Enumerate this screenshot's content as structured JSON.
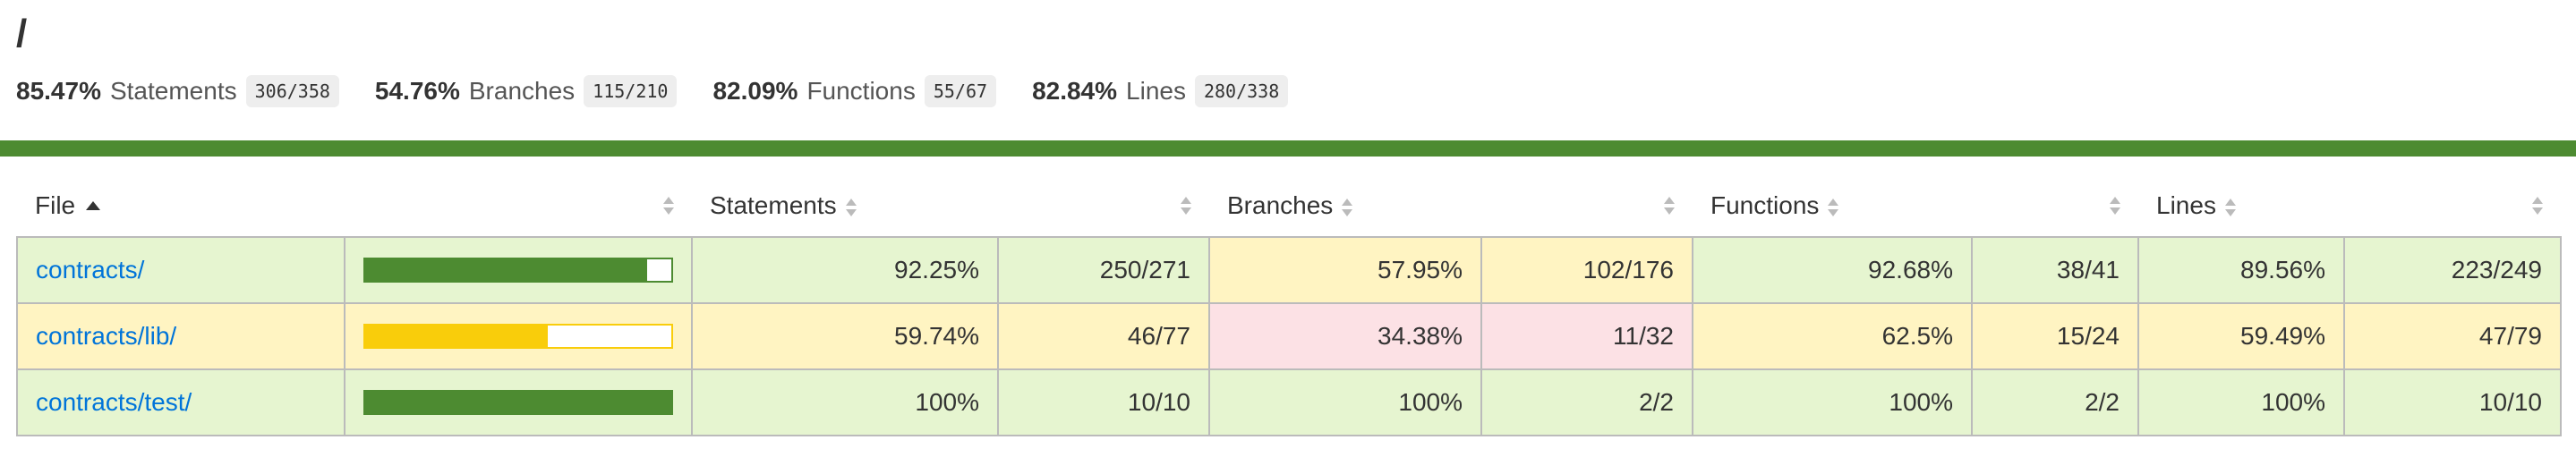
{
  "page": {
    "title": "/"
  },
  "summary": [
    {
      "pct": "85.47%",
      "label": "Statements",
      "frac": "306/358"
    },
    {
      "pct": "54.76%",
      "label": "Branches",
      "frac": "115/210"
    },
    {
      "pct": "82.09%",
      "label": "Functions",
      "frac": "55/67"
    },
    {
      "pct": "82.84%",
      "label": "Lines",
      "frac": "280/338"
    }
  ],
  "overall_status_color": "#4d8b31",
  "colors": {
    "high": "#e6f5d0",
    "medium": "#fff4c2",
    "low": "#fce1e5",
    "bar_high": "#4d8b31",
    "bar_medium": "#f9cd0b",
    "link": "#0074d9"
  },
  "table": {
    "headers": {
      "file": "File",
      "statements": "Statements",
      "branches": "Branches",
      "functions": "Functions",
      "lines": "Lines"
    },
    "sorted_by": "file",
    "sort_direction": "ascending",
    "rows": [
      {
        "file": "contracts/",
        "coverage_fraction": 0.9225,
        "bar_level": "high",
        "statements_pct": "92.25%",
        "statements_frac": "250/271",
        "statements_level": "high",
        "branches_pct": "57.95%",
        "branches_frac": "102/176",
        "branches_level": "medium",
        "functions_pct": "92.68%",
        "functions_frac": "38/41",
        "functions_level": "high",
        "lines_pct": "89.56%",
        "lines_frac": "223/249",
        "lines_level": "high"
      },
      {
        "file": "contracts/lib/",
        "coverage_fraction": 0.5974,
        "bar_level": "medium",
        "statements_pct": "59.74%",
        "statements_frac": "46/77",
        "statements_level": "medium",
        "branches_pct": "34.38%",
        "branches_frac": "11/32",
        "branches_level": "low",
        "functions_pct": "62.5%",
        "functions_frac": "15/24",
        "functions_level": "medium",
        "lines_pct": "59.49%",
        "lines_frac": "47/79",
        "lines_level": "medium"
      },
      {
        "file": "contracts/test/",
        "coverage_fraction": 1.0,
        "bar_level": "high",
        "statements_pct": "100%",
        "statements_frac": "10/10",
        "statements_level": "high",
        "branches_pct": "100%",
        "branches_frac": "2/2",
        "branches_level": "high",
        "functions_pct": "100%",
        "functions_frac": "2/2",
        "functions_level": "high",
        "lines_pct": "100%",
        "lines_frac": "10/10",
        "lines_level": "high"
      }
    ]
  }
}
